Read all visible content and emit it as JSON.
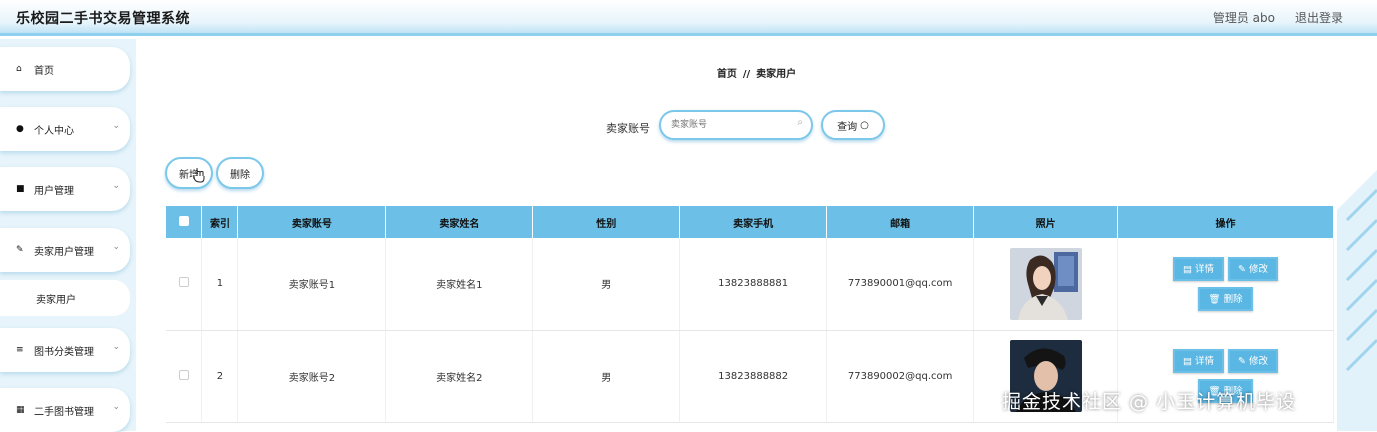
{
  "header": {
    "app_title": "乐校园二手书交易管理系统",
    "user_label": "管理员 abo",
    "logout_label": "退出登录"
  },
  "sidebar": {
    "items": [
      {
        "label": "首页",
        "icon": "home-icon",
        "has_arrow": false
      },
      {
        "label": "个人中心",
        "icon": "user-icon",
        "has_arrow": true
      },
      {
        "label": "用户管理",
        "icon": "monitor-icon",
        "has_arrow": true
      },
      {
        "label": "卖家用户管理",
        "icon": "edit-icon",
        "has_arrow": true
      },
      {
        "label": "图书分类管理",
        "icon": "list-icon",
        "has_arrow": true
      },
      {
        "label": "二手图书管理",
        "icon": "grid-icon",
        "has_arrow": true
      }
    ],
    "submenu_label": "卖家用户"
  },
  "breadcrumb": {
    "home": "首页",
    "separator": "//",
    "current": "卖家用户"
  },
  "search": {
    "label": "卖家账号",
    "placeholder": "卖家账号",
    "button": "查询"
  },
  "toolbar": {
    "add_label": "新增",
    "delete_label": "删除"
  },
  "table": {
    "headers": [
      "索引",
      "卖家账号",
      "卖家姓名",
      "性别",
      "卖家手机",
      "邮箱",
      "照片",
      "操作"
    ],
    "rows": [
      {
        "index": "1",
        "account": "卖家账号1",
        "name": "卖家姓名1",
        "gender": "男",
        "phone": "13823888881",
        "email": "773890001@qq.com"
      },
      {
        "index": "2",
        "account": "卖家账号2",
        "name": "卖家姓名2",
        "gender": "男",
        "phone": "13823888882",
        "email": "773890002@qq.com"
      }
    ],
    "actions": {
      "detail": "详情",
      "edit": "修改",
      "delete": "删除"
    }
  },
  "watermark": "掘金技术社区 @ 小玉计算机毕设",
  "colors": {
    "accent": "#6cbfe6",
    "button": "#5ab6e3",
    "sidebar_bg": "#e7f4fb"
  }
}
